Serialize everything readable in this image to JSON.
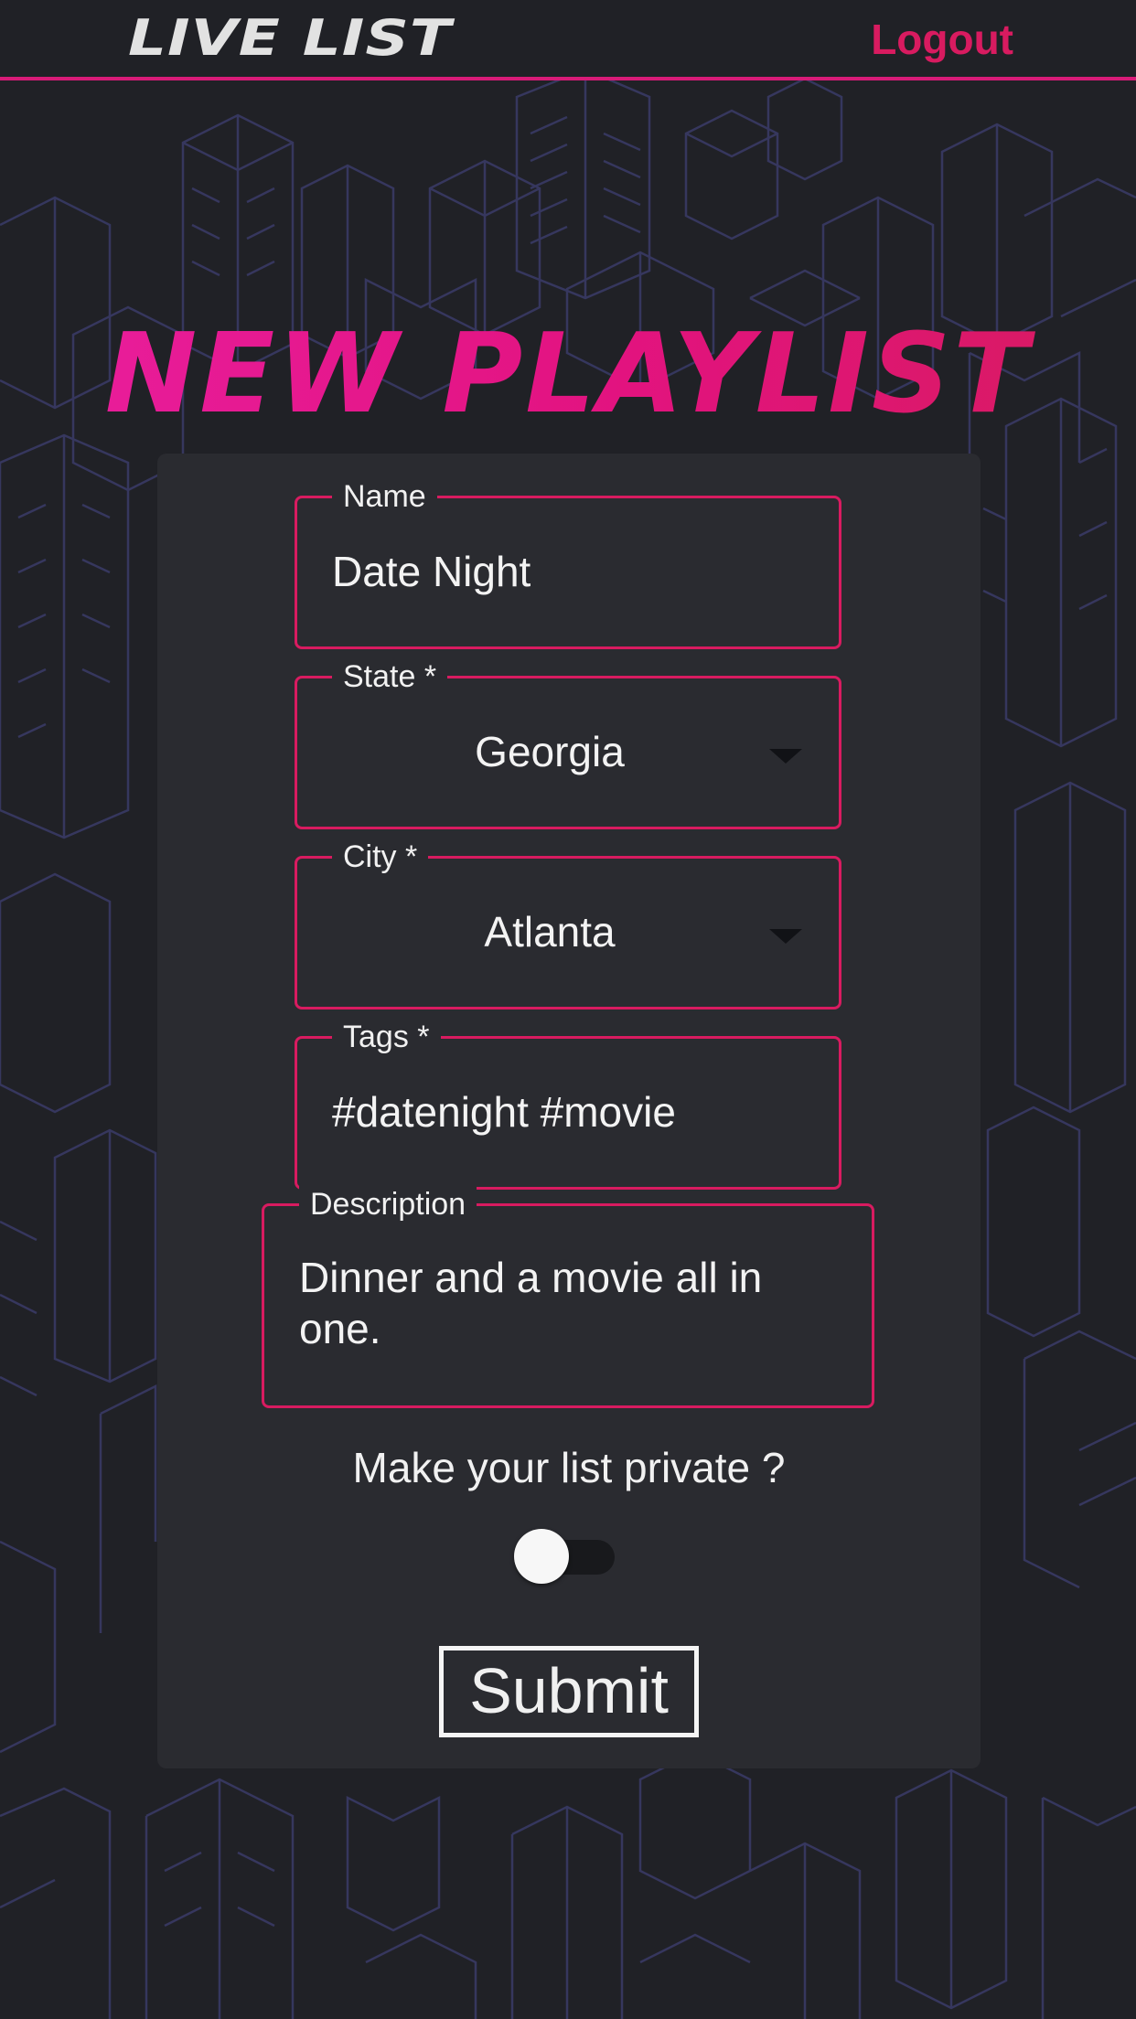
{
  "header": {
    "logo_text": "LIVE LIST",
    "logout_label": "Logout"
  },
  "page": {
    "title": "NEW PLAYLIST"
  },
  "form": {
    "name": {
      "label": "Name",
      "value": "Date Night"
    },
    "state": {
      "label": "State *",
      "value": "Georgia"
    },
    "city": {
      "label": "City *",
      "value": "Atlanta"
    },
    "tags": {
      "label": "Tags *",
      "value": "#datenight #movie"
    },
    "description": {
      "label": "Description",
      "value": "Dinner and a movie all in one."
    },
    "private_label": "Make your list private ?",
    "private_enabled": false,
    "submit_label": "Submit"
  },
  "colors": {
    "accent": "#d81b60",
    "title_gradient_start": "#e91e9e",
    "background": "#202126",
    "card": "#2a2b30",
    "line_art": "#3a3b6a"
  },
  "icons": [
    "dropdown-caret-icon"
  ]
}
